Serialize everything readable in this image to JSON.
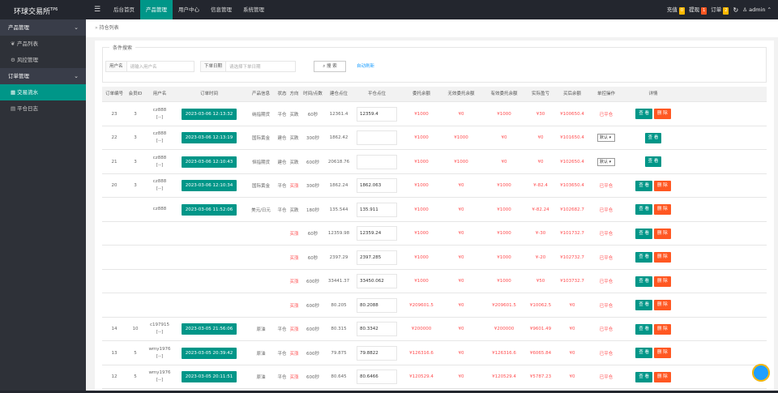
{
  "app": {
    "title": "环球交易所",
    "title_sup": "TP6"
  },
  "topnav": [
    "后台首页",
    "产品管理",
    "用户中心",
    "信息管理",
    "系统管理"
  ],
  "topnav_active": 1,
  "top_right": {
    "recharge": "充值",
    "recharge_count": "0",
    "withdraw": "提现",
    "withdraw_count": "1",
    "order": "订单",
    "order_count": "2",
    "user": "admin"
  },
  "sidebar": {
    "group1": "产品管理",
    "group1_items": [
      {
        "icon": "bulb-icon",
        "label": "产品列表"
      },
      {
        "icon": "gear-icon",
        "label": "风控管理"
      }
    ],
    "group2": "订单管理",
    "group2_items": [
      {
        "icon": "grid-icon",
        "label": "交易流水"
      },
      {
        "icon": "doc-icon",
        "label": "平仓日志"
      }
    ]
  },
  "breadcrumb": "持仓列表",
  "filter": {
    "legend": "条件搜索",
    "user_label": "用户名",
    "user_placeholder": "请输入用户名",
    "date_label": "下单日期",
    "date_placeholder": "请选择下单日期",
    "search_label": "搜 索",
    "refresh_label": "自动刷新"
  },
  "table": {
    "headers": [
      "订单编号",
      "会员ID",
      "用户名",
      "订单时间",
      "产品信息",
      "状态",
      "方向",
      "时间/点数",
      "建仓点位",
      "平仓点位",
      "委托余额",
      "无效委托余额",
      "有效委托余额",
      "实际盈亏",
      "买后余额",
      "单控操作",
      "详情"
    ],
    "rows": [
      {
        "id": "23",
        "member": "3",
        "user": "cz888",
        "user2": "[--]",
        "time": "2023-03-06 12:13:32",
        "product": "纳指期货",
        "status": "平仓",
        "dir": "买跌",
        "dir_red": false,
        "period": "60秒",
        "open": "12361.4",
        "close": "12359.4",
        "entrust": "¥1000",
        "invalid": "¥0",
        "valid": "¥1000",
        "pnl": "¥30",
        "after": "¥100650.4",
        "ctrl": "已平仓",
        "select": "",
        "view": "查 看",
        "del": "删 除"
      },
      {
        "id": "22",
        "member": "3",
        "user": "cz888",
        "user2": "[--]",
        "time": "2023-03-06 12:13:19",
        "product": "国际黄金",
        "status": "建仓",
        "dir": "买跌",
        "dir_red": false,
        "period": "300秒",
        "open": "1862.42",
        "close": "",
        "entrust": "¥1000",
        "invalid": "¥1000",
        "valid": "¥0",
        "pnl": "¥0",
        "after": "¥101650.4",
        "ctrl": "",
        "select": "默认",
        "view": "查 看",
        "del": ""
      },
      {
        "id": "21",
        "member": "3",
        "user": "cz888",
        "user2": "[--]",
        "time": "2023-03-06 12:10:43",
        "product": "恒指期货",
        "status": "建仓",
        "dir": "买跌",
        "dir_red": false,
        "period": "600秒",
        "open": "20618.76",
        "close": "",
        "entrust": "¥1000",
        "invalid": "¥1000",
        "valid": "¥0",
        "pnl": "¥0",
        "after": "¥102650.4",
        "ctrl": "",
        "select": "默认",
        "view": "查 看",
        "del": ""
      },
      {
        "id": "20",
        "member": "3",
        "user": "cz888",
        "user2": "[--]",
        "time": "2023-03-06 12:10:34",
        "product": "国际黄金",
        "status": "平仓",
        "dir": "买涨",
        "dir_red": true,
        "period": "300秒",
        "open": "1862.24",
        "close": "1862.063",
        "entrust": "¥1000",
        "invalid": "¥0",
        "valid": "¥1000",
        "pnl": "¥-82.4",
        "after": "¥103650.4",
        "ctrl": "已平仓",
        "select": "",
        "view": "查 看",
        "del": "删 除"
      },
      {
        "id": "",
        "member": "",
        "user": "cz888",
        "user2": "",
        "time": "2023-03-06 11:52:06",
        "product": "美元/日元",
        "status": "平仓",
        "dir": "买跌",
        "dir_red": false,
        "period": "180秒",
        "open": "135.544",
        "close": "135.911",
        "entrust": "¥1000",
        "invalid": "¥0",
        "valid": "¥1000",
        "pnl": "¥-82.24",
        "after": "¥102682.7",
        "ctrl": "已平仓",
        "select": "",
        "view": "查 看",
        "del": "删 除"
      },
      {
        "id": "",
        "member": "",
        "user": "",
        "user2": "",
        "time": "",
        "product": "",
        "status": "",
        "dir": "买涨",
        "dir_red": true,
        "period": "60秒",
        "open": "12359.98",
        "close": "12359.24",
        "entrust": "¥1000",
        "invalid": "¥0",
        "valid": "¥1000",
        "pnl": "¥-30",
        "after": "¥101732.7",
        "ctrl": "已平仓",
        "select": "",
        "view": "查 看",
        "del": "删 除"
      },
      {
        "id": "",
        "member": "",
        "user": "",
        "user2": "",
        "time": "",
        "product": "",
        "status": "",
        "dir": "买涨",
        "dir_red": true,
        "period": "60秒",
        "open": "2397.29",
        "close": "2397.285",
        "entrust": "¥1000",
        "invalid": "¥0",
        "valid": "¥1000",
        "pnl": "¥-20",
        "after": "¥102732.7",
        "ctrl": "已平仓",
        "select": "",
        "view": "查 看",
        "del": "删 除"
      },
      {
        "id": "",
        "member": "",
        "user": "",
        "user2": "",
        "time": "",
        "product": "",
        "status": "",
        "dir": "买涨",
        "dir_red": true,
        "period": "600秒",
        "open": "33441.37",
        "close": "33450.062",
        "entrust": "¥1000",
        "invalid": "¥0",
        "valid": "¥1000",
        "pnl": "¥50",
        "after": "¥103732.7",
        "ctrl": "已平仓",
        "select": "",
        "view": "查 看",
        "del": "删 除"
      },
      {
        "id": "",
        "member": "",
        "user": "",
        "user2": "",
        "time": "",
        "product": "",
        "status": "",
        "dir": "买涨",
        "dir_red": true,
        "period": "600秒",
        "open": "80.205",
        "close": "80.2088",
        "entrust": "¥209601.5",
        "invalid": "¥0",
        "valid": "¥209601.5",
        "pnl": "¥10062.5",
        "after": "¥0",
        "ctrl": "已平仓",
        "select": "",
        "view": "查 看",
        "del": "删 除"
      },
      {
        "id": "14",
        "member": "10",
        "user": "c197915",
        "user2": "[--]",
        "time": "2023-03-05 21:56:06",
        "product": "原油",
        "status": "平仓",
        "dir": "买涨",
        "dir_red": true,
        "period": "600秒",
        "open": "80.315",
        "close": "80.3342",
        "entrust": "¥200000",
        "invalid": "¥0",
        "valid": "¥200000",
        "pnl": "¥9601.49",
        "after": "¥0",
        "ctrl": "已平仓",
        "select": "",
        "view": "查 看",
        "del": "删 除"
      },
      {
        "id": "13",
        "member": "5",
        "user": "wmy1976",
        "user2": "[--]",
        "time": "2023-03-05 20:39:42",
        "product": "原油",
        "status": "平仓",
        "dir": "买涨",
        "dir_red": true,
        "period": "600秒",
        "open": "79.875",
        "close": "79.8822",
        "entrust": "¥126316.6",
        "invalid": "¥0",
        "valid": "¥126316.6",
        "pnl": "¥6065.84",
        "after": "¥0",
        "ctrl": "已平仓",
        "select": "",
        "view": "查 看",
        "del": "删 除"
      },
      {
        "id": "12",
        "member": "5",
        "user": "wmy1976",
        "user2": "[--]",
        "time": "2023-03-05 20:11:51",
        "product": "原油",
        "status": "平仓",
        "dir": "买涨",
        "dir_red": true,
        "period": "600秒",
        "open": "80.645",
        "close": "80.6466",
        "entrust": "¥120529.4",
        "invalid": "¥0",
        "valid": "¥120529.4",
        "pnl": "¥5787.23",
        "after": "¥0",
        "ctrl": "已平仓",
        "select": "",
        "view": "查 看",
        "del": "删 除"
      }
    ]
  },
  "colors": {
    "accent": "#009688",
    "danger": "#ff5722",
    "red_text": "#ff4d4f",
    "dark": "#23262e"
  }
}
